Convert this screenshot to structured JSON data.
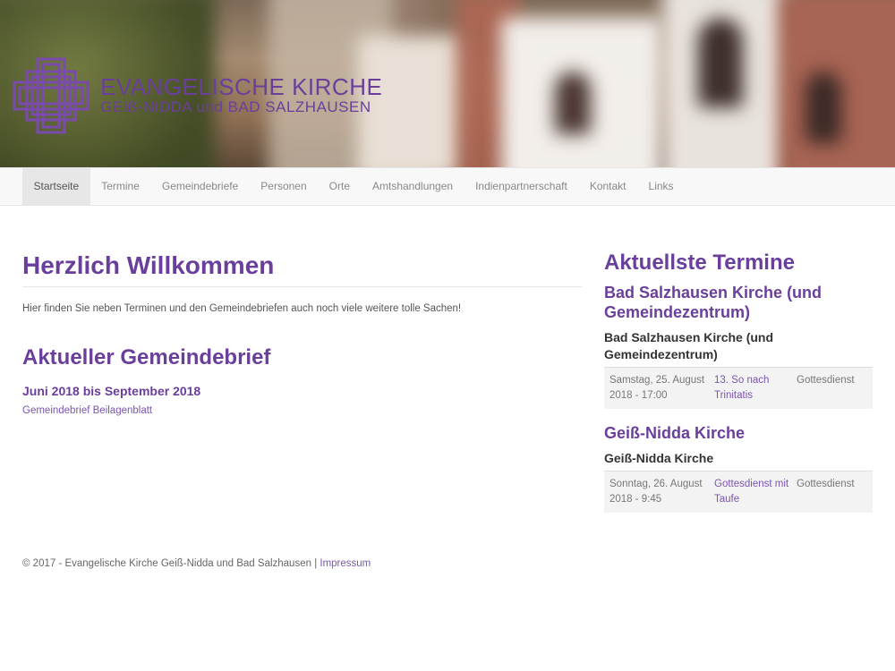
{
  "header": {
    "logo_line1": "EVANGELISCHE KIRCHE",
    "logo_line2": "GEIß-NIDDA und BAD SALZHAUSEN",
    "brand_color": "#6a3f9b"
  },
  "nav": {
    "items": [
      {
        "label": "Startseite",
        "active": true
      },
      {
        "label": "Termine"
      },
      {
        "label": "Gemeindebriefe"
      },
      {
        "label": "Personen"
      },
      {
        "label": "Orte"
      },
      {
        "label": "Amtshandlungen"
      },
      {
        "label": "Indienpartnerschaft"
      },
      {
        "label": "Kontakt"
      },
      {
        "label": "Links"
      }
    ]
  },
  "main": {
    "title": "Herzlich Willkommen",
    "intro": "Hier finden Sie neben Terminen und den Gemeindebriefen auch noch viele weitere tolle Sachen!",
    "brief_title": "Aktueller Gemeindebrief",
    "brief_period": "Juni 2018 bis September 2018",
    "brief_link": "Gemeindebrief Beilagenblatt"
  },
  "sidebar": {
    "title": "Aktuellste Termine",
    "groups": [
      {
        "heading": "Bad Salzhausen Kirche (und Gemeindezentrum)",
        "subheading": "Bad Salzhausen Kirche (und Gemeindezentrum)",
        "event": {
          "date": "Samstag, 25. August 2018 - 17:00",
          "name": "13. So nach Trinitatis",
          "type": "Gottesdienst"
        }
      },
      {
        "heading": "Geiß-Nidda Kirche",
        "subheading": "Geiß-Nidda Kirche",
        "event": {
          "date": "Sonntag, 26. August 2018 - 9:45",
          "name": "Gottesdienst mit Taufe",
          "type": "Gottesdienst"
        }
      }
    ]
  },
  "footer": {
    "copyright": "© 2017 - Evangelische Kirche Geiß-Nidda und Bad Salzhausen |",
    "impressum": "Impressum"
  }
}
